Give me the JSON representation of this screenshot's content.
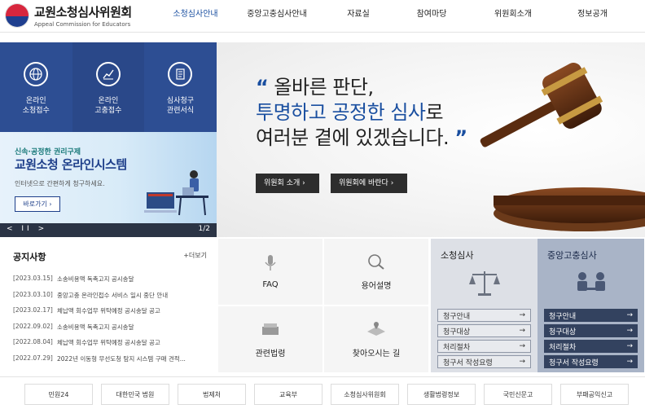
{
  "header": {
    "logo_title": "교원소청심사위원회",
    "logo_subtitle": "Appeal Commission for Educators",
    "nav": [
      "소청심사안내",
      "중앙고충심사안내",
      "자료실",
      "참여마당",
      "위원회소개",
      "정보공개"
    ],
    "active_nav": "소청심사안내"
  },
  "quick_menu": [
    {
      "label": "온라인\n소청접수",
      "icon": "globe-icon"
    },
    {
      "label": "온라인\n고충접수",
      "icon": "chart-icon"
    },
    {
      "label": "심사청구\n관련서식",
      "icon": "document-icon"
    }
  ],
  "promo": {
    "kicker": "신속·공정한 권리구제",
    "title": "교원소청 온라인시스템",
    "description": "인터넷으로 간편하게 청구하세요.",
    "button": "바로가기",
    "controls": "< II >",
    "page": "1/2"
  },
  "hero": {
    "line1": "올바른 판단,",
    "line2_blue": "투명하고 공정한 심사",
    "line2_rest": "로",
    "line3": "여러분 곁에 있겠습니다.",
    "open_quote": "“",
    "close_quote": "”",
    "btn_about": "위원회 소개",
    "btn_wish": "위원회에 바란다"
  },
  "notice": {
    "title": "공지사항",
    "more": "+더보기",
    "items": [
      {
        "date": "[2023.03.15]",
        "text": "소송비용액 독촉고지 공시송달"
      },
      {
        "date": "[2023.03.10]",
        "text": "중앙고충 온라인접수 서비스 일시 중단 안내"
      },
      {
        "date": "[2023.02.17]",
        "text": "체납액 회수업무 위탁예정 공시송달 공고"
      },
      {
        "date": "[2022.09.02]",
        "text": "소송비용액 독촉고지 공시송달"
      },
      {
        "date": "[2022.08.04]",
        "text": "체납액 회수업무 위탁예정 공시송달 공고"
      },
      {
        "date": "[2022.07.29]",
        "text": "2022년 이동형 무선도청 탐지 시스템 구매 견적..."
      }
    ]
  },
  "services": [
    {
      "label": "FAQ",
      "icon": "microphone-icon"
    },
    {
      "label": "용어설명",
      "icon": "magnifier-icon"
    },
    {
      "label": "관련법령",
      "icon": "book-icon"
    },
    {
      "label": "찾아오시는 길",
      "icon": "map-icon"
    }
  ],
  "panel_appeal": {
    "title": "소청심사",
    "icon": "scales-icon",
    "links": [
      "청구안내",
      "청구대상",
      "처리절차",
      "청구서 작성요령"
    ]
  },
  "panel_grievance": {
    "title": "중앙고충심사",
    "icon": "meeting-icon",
    "links": [
      "청구안내",
      "청구대상",
      "처리절차",
      "청구서 작성요령"
    ]
  },
  "banners": [
    "민원24",
    "대한민국 법원",
    "법제처",
    "교육부",
    "소청심사위원회",
    "생활법령정보",
    "국민신문고",
    "부패공익신고"
  ]
}
